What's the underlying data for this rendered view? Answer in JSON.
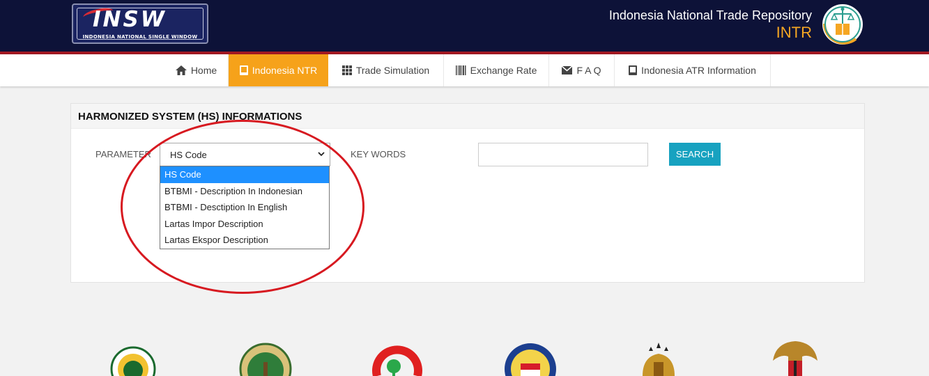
{
  "header": {
    "insw_logo_text": "INSW",
    "insw_logo_subtitle": "INDONESIA NATIONAL SINGLE WINDOW",
    "repo_title": "Indonesia National Trade Repository",
    "repo_abbr": "INTR"
  },
  "nav": {
    "items": [
      {
        "label": "Home",
        "icon": "home-icon"
      },
      {
        "label": "Indonesia NTR",
        "icon": "book-icon"
      },
      {
        "label": "Trade Simulation",
        "icon": "grid-icon"
      },
      {
        "label": "Exchange Rate",
        "icon": "barcode-icon"
      },
      {
        "label": "F A Q",
        "icon": "envelope-icon"
      },
      {
        "label": "Indonesia ATR Information",
        "icon": "book-icon"
      }
    ],
    "active_index": 1
  },
  "panel": {
    "title": "HARMONIZED SYSTEM (HS) INFORMATIONS",
    "parameter_label": "PARAMETER",
    "parameter_selected": "HS Code",
    "parameter_options": [
      "HS Code",
      "BTBMI - Description In Indonesian",
      "BTBMI - Desctiption In English",
      "Lartas Impor Description",
      "Lartas Ekspor Description"
    ],
    "keywords_label": "KEY WORDS",
    "keywords_value": "",
    "search_label": "SEARCH"
  },
  "colors": {
    "header_bg": "#0d1238",
    "header_line": "#a11822",
    "nav_active": "#f6a21a",
    "search_button": "#17a2c0",
    "option_highlight": "#1e90ff",
    "annotation": "#d71920",
    "intr_accent": "#f5a623"
  },
  "bottom_logos": [
    "badan-karantina-pertanian-logo",
    "kementerian-lingkungan-hidup-kehutanan-logo",
    "kementerian-perindustrian-logo",
    "kementerian-pertahanan-logo",
    "polri-logo",
    "garuda-pancasila-logo"
  ]
}
